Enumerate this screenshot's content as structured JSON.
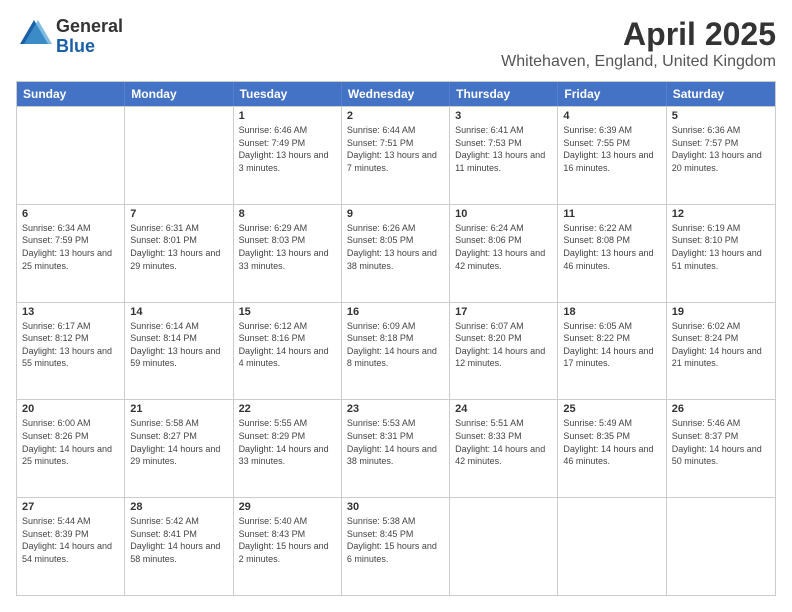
{
  "logo": {
    "general": "General",
    "blue": "Blue"
  },
  "header": {
    "title": "April 2025",
    "subtitle": "Whitehaven, England, United Kingdom"
  },
  "calendar": {
    "days": [
      "Sunday",
      "Monday",
      "Tuesday",
      "Wednesday",
      "Thursday",
      "Friday",
      "Saturday"
    ],
    "rows": [
      [
        {
          "day": "",
          "info": ""
        },
        {
          "day": "",
          "info": ""
        },
        {
          "day": "1",
          "info": "Sunrise: 6:46 AM\nSunset: 7:49 PM\nDaylight: 13 hours and 3 minutes."
        },
        {
          "day": "2",
          "info": "Sunrise: 6:44 AM\nSunset: 7:51 PM\nDaylight: 13 hours and 7 minutes."
        },
        {
          "day": "3",
          "info": "Sunrise: 6:41 AM\nSunset: 7:53 PM\nDaylight: 13 hours and 11 minutes."
        },
        {
          "day": "4",
          "info": "Sunrise: 6:39 AM\nSunset: 7:55 PM\nDaylight: 13 hours and 16 minutes."
        },
        {
          "day": "5",
          "info": "Sunrise: 6:36 AM\nSunset: 7:57 PM\nDaylight: 13 hours and 20 minutes."
        }
      ],
      [
        {
          "day": "6",
          "info": "Sunrise: 6:34 AM\nSunset: 7:59 PM\nDaylight: 13 hours and 25 minutes."
        },
        {
          "day": "7",
          "info": "Sunrise: 6:31 AM\nSunset: 8:01 PM\nDaylight: 13 hours and 29 minutes."
        },
        {
          "day": "8",
          "info": "Sunrise: 6:29 AM\nSunset: 8:03 PM\nDaylight: 13 hours and 33 minutes."
        },
        {
          "day": "9",
          "info": "Sunrise: 6:26 AM\nSunset: 8:05 PM\nDaylight: 13 hours and 38 minutes."
        },
        {
          "day": "10",
          "info": "Sunrise: 6:24 AM\nSunset: 8:06 PM\nDaylight: 13 hours and 42 minutes."
        },
        {
          "day": "11",
          "info": "Sunrise: 6:22 AM\nSunset: 8:08 PM\nDaylight: 13 hours and 46 minutes."
        },
        {
          "day": "12",
          "info": "Sunrise: 6:19 AM\nSunset: 8:10 PM\nDaylight: 13 hours and 51 minutes."
        }
      ],
      [
        {
          "day": "13",
          "info": "Sunrise: 6:17 AM\nSunset: 8:12 PM\nDaylight: 13 hours and 55 minutes."
        },
        {
          "day": "14",
          "info": "Sunrise: 6:14 AM\nSunset: 8:14 PM\nDaylight: 13 hours and 59 minutes."
        },
        {
          "day": "15",
          "info": "Sunrise: 6:12 AM\nSunset: 8:16 PM\nDaylight: 14 hours and 4 minutes."
        },
        {
          "day": "16",
          "info": "Sunrise: 6:09 AM\nSunset: 8:18 PM\nDaylight: 14 hours and 8 minutes."
        },
        {
          "day": "17",
          "info": "Sunrise: 6:07 AM\nSunset: 8:20 PM\nDaylight: 14 hours and 12 minutes."
        },
        {
          "day": "18",
          "info": "Sunrise: 6:05 AM\nSunset: 8:22 PM\nDaylight: 14 hours and 17 minutes."
        },
        {
          "day": "19",
          "info": "Sunrise: 6:02 AM\nSunset: 8:24 PM\nDaylight: 14 hours and 21 minutes."
        }
      ],
      [
        {
          "day": "20",
          "info": "Sunrise: 6:00 AM\nSunset: 8:26 PM\nDaylight: 14 hours and 25 minutes."
        },
        {
          "day": "21",
          "info": "Sunrise: 5:58 AM\nSunset: 8:27 PM\nDaylight: 14 hours and 29 minutes."
        },
        {
          "day": "22",
          "info": "Sunrise: 5:55 AM\nSunset: 8:29 PM\nDaylight: 14 hours and 33 minutes."
        },
        {
          "day": "23",
          "info": "Sunrise: 5:53 AM\nSunset: 8:31 PM\nDaylight: 14 hours and 38 minutes."
        },
        {
          "day": "24",
          "info": "Sunrise: 5:51 AM\nSunset: 8:33 PM\nDaylight: 14 hours and 42 minutes."
        },
        {
          "day": "25",
          "info": "Sunrise: 5:49 AM\nSunset: 8:35 PM\nDaylight: 14 hours and 46 minutes."
        },
        {
          "day": "26",
          "info": "Sunrise: 5:46 AM\nSunset: 8:37 PM\nDaylight: 14 hours and 50 minutes."
        }
      ],
      [
        {
          "day": "27",
          "info": "Sunrise: 5:44 AM\nSunset: 8:39 PM\nDaylight: 14 hours and 54 minutes."
        },
        {
          "day": "28",
          "info": "Sunrise: 5:42 AM\nSunset: 8:41 PM\nDaylight: 14 hours and 58 minutes."
        },
        {
          "day": "29",
          "info": "Sunrise: 5:40 AM\nSunset: 8:43 PM\nDaylight: 15 hours and 2 minutes."
        },
        {
          "day": "30",
          "info": "Sunrise: 5:38 AM\nSunset: 8:45 PM\nDaylight: 15 hours and 6 minutes."
        },
        {
          "day": "",
          "info": ""
        },
        {
          "day": "",
          "info": ""
        },
        {
          "day": "",
          "info": ""
        }
      ]
    ]
  }
}
